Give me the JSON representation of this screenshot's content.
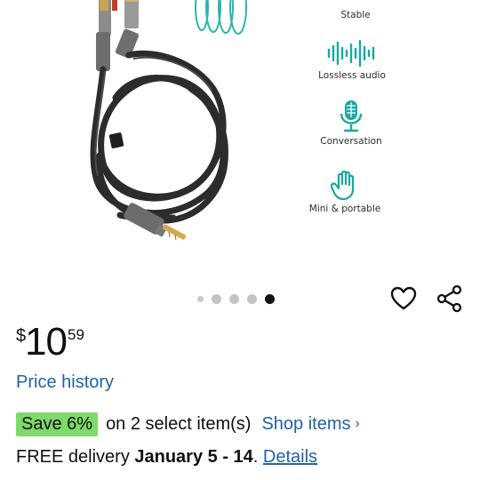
{
  "features": [
    {
      "label": "Stable",
      "icon": "shield-check-icon"
    },
    {
      "label": "Lossless audio",
      "icon": "sound-wave-icon"
    },
    {
      "label": "Conversation",
      "icon": "microphone-icon"
    },
    {
      "label": "Mini & portable",
      "icon": "hand-icon"
    }
  ],
  "carousel": {
    "total": 5,
    "active_index": 4
  },
  "price": {
    "currency": "$",
    "whole": "10",
    "fraction": "59"
  },
  "price_history_label": "Price history",
  "promo": {
    "badge": "Save 6%",
    "text": "on 2 select item(s)",
    "link": "Shop items",
    "chevron": "›"
  },
  "delivery": {
    "prefix": "FREE delivery ",
    "date": "January 5 - 14",
    "separator": ". ",
    "link": "Details"
  },
  "colors": {
    "accent_teal": "#17a9a0",
    "link_blue": "#2162a1",
    "save_green": "#7fda69"
  }
}
